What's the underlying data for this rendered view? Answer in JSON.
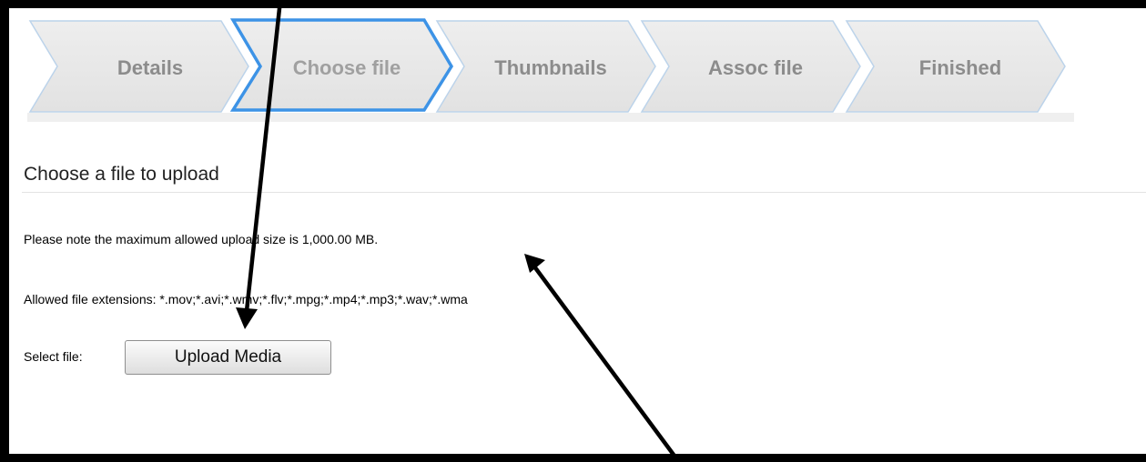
{
  "wizard": {
    "active_step": "Choose file",
    "steps": [
      "Details",
      "Choose file",
      "Thumbnails",
      "Assoc file",
      "Finished"
    ]
  },
  "upload": {
    "heading": "Choose a file to upload",
    "size_note": "Please note the maximum allowed upload size is 1,000.00 MB.",
    "extensions": "Allowed file extensions: *.mov;*.avi;*.wmv;*.flv;*.mpg;*.mp4;*.mp3;*.wav;*.wma",
    "select_label": "Select file:",
    "button_label": "Upload Media"
  },
  "colors": {
    "step_fill": "#e6e6e6",
    "step_border": "#bcd3ea",
    "active_border": "#3d93e6",
    "step_text": "#8c8c8c"
  }
}
